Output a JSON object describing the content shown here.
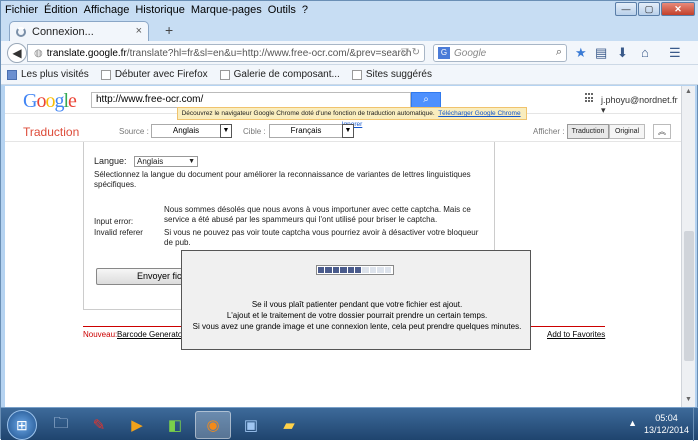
{
  "window": {
    "menus": [
      "Fichier",
      "Édition",
      "Affichage",
      "Historique",
      "Marque-pages",
      "Outils",
      "?"
    ],
    "controls": {
      "min": "—",
      "max": "▢",
      "close": "✕"
    }
  },
  "tab": {
    "title": "Connexion...",
    "close": "×",
    "new": "+"
  },
  "nav": {
    "url_domain": "translate.google.fr",
    "url_rest": "/translate?hl=fr&sl=en&u=http://www.free-ocr.com/&prev=search",
    "search_placeholder": "Google",
    "search_engine": "G"
  },
  "bookmarks": [
    "Les plus visités",
    "Débuter avec Firefox",
    "Galerie de composant...",
    "Sites suggérés"
  ],
  "google": {
    "logo": "Google",
    "url_field": "http://www.free-ocr.com/",
    "user": "j.phoyu@nordnet.fr ▾",
    "chrome_prompt": "Découvrez le navigateur Google Chrome doté d'une fonction de traduction automatique.",
    "chrome_download": "Télécharger Google Chrome",
    "chrome_ignore": "Ignorer"
  },
  "translate": {
    "title": "Traduction",
    "source_label": "Source :",
    "source_value": "Anglais",
    "target_label": "Cible :",
    "target_value": "Français",
    "show_label": "Afficher :",
    "show_translation": "Traduction",
    "show_original": "Original",
    "collapse": "︽"
  },
  "content": {
    "language_label": "Langue:",
    "language_value": "Anglais",
    "language_desc": "Sélectionnez la langue du document pour améliorer la reconnaissance de variantes de lettres linguistiques spécifiques.",
    "error_msg": "Nous sommes désolés que nous avons à vous importuner avec cette captcha. Mais ce service a été abusé par les spammeurs qui l'ont utilisé pour briser le captcha.",
    "input_error_label": "Input error:",
    "invalid_referer_label": "Invalid referer",
    "error_msg2": "Si vous ne pouvez pas voir toute captcha vous pourriez avoir à désactiver votre bloqueur de pub.",
    "send_button": "Envoyer fich",
    "new_label": "Nouveau:",
    "barcode_link": "Barcode Generato",
    "favorites_link": "Add to Favorites"
  },
  "modal": {
    "progress": 0.6,
    "segments": 10,
    "line1": "Se il vous plaît patienter pendant que votre fichier est ajout.",
    "line2": "L'ajout et le traitement de votre dossier pourrait prendre un certain temps.",
    "line3": "Si vous avez une grande image et une connexion lente, cela peut prendre quelques minutes."
  },
  "taskbar": {
    "time": "05:04",
    "date": "13/12/2014"
  },
  "colors": {
    "accent": "#dd4b39",
    "google_blue": "#4d90fe",
    "progress": "#4a5b8c"
  }
}
